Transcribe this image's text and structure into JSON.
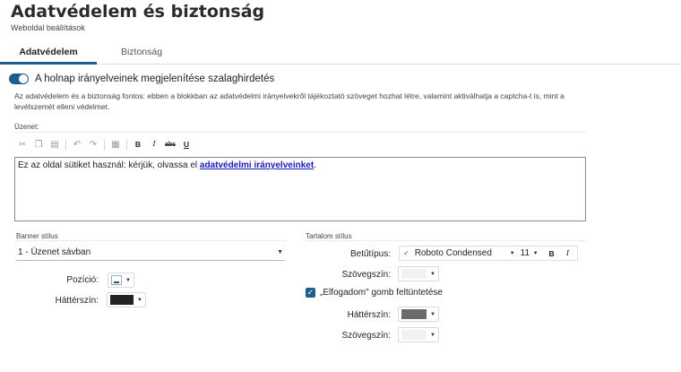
{
  "header": {
    "title": "Adatvédelem és biztonság",
    "subtitle": "Weboldal beállítások"
  },
  "tabs": [
    {
      "label": "Adatvédelem",
      "active": true
    },
    {
      "label": "Biztonság",
      "active": false
    }
  ],
  "banner_toggle": {
    "label": "A holnap irányelveinek megjelenítése szalaghirdetés",
    "on": true
  },
  "description": "Az adatvédelem és a biztonság fontos: ebben a blokkban az adatvédelmi irányelvekről tájékoztató szöveget hozhat létre, valamint aktiválhatja a captcha-t is, mint a levélszemét elleni védelmet.",
  "message": {
    "label": "Üzenet:",
    "text_before": "Ez az oldal sütiket használ: kérjük, olvassa el ",
    "link_text": "adatvédelmi irányelveinket",
    "text_after": "."
  },
  "toolbar": {
    "bold": "B",
    "italic": "I",
    "strike": "abc",
    "underline": "U"
  },
  "banner_style": {
    "section_label": "Banner stílus",
    "selected": "1 - Üzenet sávban",
    "position_label": "Pozíció:",
    "bg_label": "Háttérszín:",
    "bg_color": "#222222"
  },
  "content_style": {
    "section_label": "Tartalom stílus",
    "font_label": "Betűtípus:",
    "font_name": "Roboto Condensed",
    "font_size": "11",
    "bold": "B",
    "italic": "I",
    "text_color_label": "Szövegszín:",
    "text_color": "#f2f2f2",
    "accept_checkbox_label": "„Elfogadom\" gomb feltüntetése",
    "accept_checked": true,
    "button_bg_label": "Háttérszín:",
    "button_bg_color": "#6b6b6b",
    "button_text_color_label": "Szövegszín:",
    "button_text_color": "#f2f2f2"
  },
  "colors": {
    "accent": "#1b5f8f",
    "link": "#1a1ad0"
  }
}
